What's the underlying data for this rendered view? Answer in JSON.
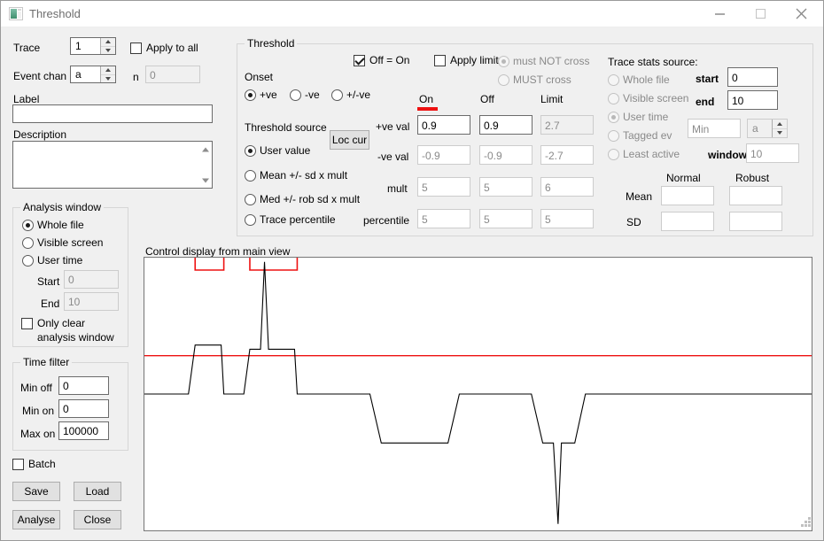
{
  "window": {
    "title": "Threshold",
    "icon": "app-icon",
    "minimize": "minimize-icon",
    "maximize": "maximize-icon",
    "close": "close-icon"
  },
  "left": {
    "trace_label": "Trace",
    "trace_value": "1",
    "apply_to_all": "Apply to all",
    "apply_to_all_checked": false,
    "event_chan_label": "Event chan",
    "event_chan_value": "a",
    "n_label": "n",
    "n_value": "0",
    "label_label": "Label",
    "label_value": "",
    "description_label": "Description",
    "description_value": "",
    "analysis_window": {
      "title": "Analysis window",
      "options": [
        {
          "label": "Whole file",
          "selected": true
        },
        {
          "label": "Visible screen",
          "selected": false
        },
        {
          "label": "User time",
          "selected": false
        }
      ],
      "start_label": "Start",
      "start_value": "0",
      "end_label": "End",
      "end_value": "10",
      "only_clear_line1": "Only clear",
      "only_clear_line2": "analysis window",
      "only_clear_checked": false
    },
    "time_filter": {
      "title": "Time filter",
      "min_off_label": "Min off",
      "min_off_value": "0",
      "min_on_label": "Min on",
      "min_on_value": "0",
      "max_on_label": "Max on",
      "max_on_value": "100000"
    },
    "batch_label": "Batch",
    "batch_checked": false,
    "save_label": "Save",
    "load_label": "Load",
    "analyse_label": "Analyse",
    "close_label": "Close"
  },
  "threshold": {
    "title": "Threshold",
    "off_equals_on_label": "Off = On",
    "off_equals_on_checked": true,
    "apply_limit_label": "Apply limit",
    "apply_limit_checked": false,
    "cross_options": [
      {
        "label": "must NOT cross",
        "selected": true,
        "disabled": true
      },
      {
        "label": "MUST cross",
        "selected": false,
        "disabled": true
      }
    ],
    "onset_label": "Onset",
    "onset_options": [
      {
        "label": "+ve",
        "selected": true
      },
      {
        "label": "-ve",
        "selected": false
      },
      {
        "label": "+/-ve",
        "selected": false
      }
    ],
    "source_label": "Threshold source",
    "loc_cur_label": "Loc cur",
    "source_options": [
      {
        "label": "User value",
        "selected": true
      },
      {
        "label": "Mean +/- sd x mult",
        "selected": false
      },
      {
        "label": "Med +/- rob sd x mult",
        "selected": false
      },
      {
        "label": "Trace percentile",
        "selected": false
      }
    ],
    "columns": [
      "On",
      "Off",
      "Limit"
    ],
    "rows": [
      {
        "label": "+ve val",
        "values": [
          "0.9",
          "0.9",
          "2.7"
        ],
        "enabled": [
          true,
          true,
          false
        ]
      },
      {
        "label": "-ve val",
        "values": [
          "-0.9",
          "-0.9",
          "-2.7"
        ],
        "enabled": [
          false,
          false,
          false
        ]
      },
      {
        "label": "mult",
        "values": [
          "5",
          "5",
          "6"
        ],
        "enabled": [
          false,
          false,
          false
        ]
      },
      {
        "label": "percentile",
        "values": [
          "5",
          "5",
          "5"
        ],
        "enabled": [
          false,
          false,
          false
        ]
      }
    ]
  },
  "trace_stats": {
    "title": "Trace stats source:",
    "options": [
      {
        "label": "Whole file",
        "selected": false,
        "disabled": true
      },
      {
        "label": "Visible screen",
        "selected": false,
        "disabled": true
      },
      {
        "label": "User time",
        "selected": true,
        "disabled": true
      },
      {
        "label": "Tagged ev",
        "selected": false,
        "disabled": true
      },
      {
        "label": "Least active",
        "selected": false,
        "disabled": true
      }
    ],
    "start_label": "start",
    "start_value": "0",
    "end_label": "end",
    "end_value": "10",
    "min_placeholder": "Min",
    "chan_value": "a",
    "window_label": "window",
    "window_value": "10",
    "stats_columns": [
      "Normal",
      "Robust"
    ],
    "stats_rows": [
      {
        "label": "Mean",
        "values": [
          "",
          ""
        ]
      },
      {
        "label": "SD",
        "values": [
          "",
          ""
        ]
      }
    ]
  },
  "chart": {
    "caption": "Control display from main view",
    "threshold_color": "#ee1111",
    "trace_color": "#000000",
    "event_color": "#ee1111"
  },
  "chart_data": {
    "type": "line",
    "title": "Control display from main view",
    "xlabel": "",
    "ylabel": "",
    "xlim": [
      0,
      100
    ],
    "ylim": [
      -3.2,
      3.2
    ],
    "grid": false,
    "legend": null,
    "threshold_line": 0.9,
    "baseline": 0.0,
    "event_markers": [
      {
        "start": 7.6,
        "end": 11.9
      },
      {
        "start": 15.8,
        "end": 22.9
      }
    ],
    "series": [
      {
        "name": "trace",
        "color": "#000000",
        "x": [
          0,
          6.6,
          7.6,
          8.0,
          11.5,
          11.9,
          13.5,
          14.9,
          15.8,
          17.4,
          18.0,
          18.6,
          19.2,
          22.5,
          22.9,
          25.0,
          33.8,
          35.5,
          45.5,
          47.2,
          58.0,
          59.7,
          61.3,
          62.0,
          62.5,
          63.5,
          64.5,
          66.1,
          100
        ],
        "y": [
          0,
          0,
          1.15,
          1.15,
          1.15,
          0,
          0,
          0,
          1.05,
          1.05,
          3.1,
          1.05,
          1.05,
          1.05,
          0,
          0,
          0,
          -1.15,
          -1.15,
          0,
          0,
          -1.15,
          -1.15,
          -3.05,
          -1.15,
          -1.15,
          -1.15,
          0,
          0
        ]
      }
    ]
  }
}
